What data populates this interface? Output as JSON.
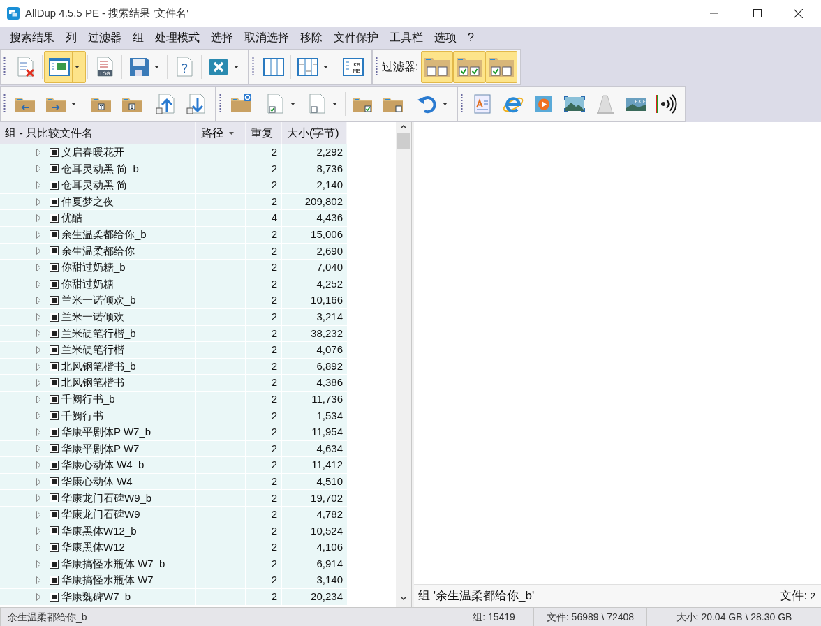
{
  "window": {
    "title": "AllDup 4.5.5 PE - 搜索结果 '文件名'"
  },
  "menu": [
    "搜索结果",
    "列",
    "过滤器",
    "组",
    "处理模式",
    "选择",
    "取消选择",
    "移除",
    "文件保护",
    "工具栏",
    "选项",
    "?"
  ],
  "toolbar_1": [
    {
      "kind": "report",
      "selected": false,
      "dropdown": false
    },
    {
      "kind": "view",
      "selected": true,
      "dropdown": true
    },
    {
      "kind": "log",
      "selected": false,
      "dropdown": false,
      "text": "LOG"
    },
    {
      "kind": "save",
      "selected": false,
      "dropdown": true
    },
    {
      "kind": "help",
      "selected": false,
      "dropdown": false,
      "text": "?"
    },
    {
      "kind": "remove",
      "selected": false,
      "dropdown": true
    },
    {
      "kind": "columns",
      "selected": false,
      "dropdown": false
    },
    {
      "kind": "column-width",
      "selected": false,
      "dropdown": true
    },
    {
      "kind": "size-unit",
      "selected": false,
      "dropdown": false,
      "text": "KB",
      "text_2": "MB"
    }
  ],
  "filter": {
    "label": "过滤器:",
    "buttons": [
      {
        "kind": "folder-checks",
        "checks": [
          false,
          false
        ],
        "selected": true
      },
      {
        "kind": "folder-checks",
        "checks": [
          true,
          true
        ],
        "selected": true
      },
      {
        "kind": "folder-checks",
        "checks": [
          true,
          false
        ],
        "selected": true
      }
    ]
  },
  "toolbar_2": [
    {
      "kind": "folder-back",
      "dropdown": false
    },
    {
      "kind": "folder-forward",
      "dropdown": true
    },
    {
      "kind": "folder-up-open",
      "dropdown": false
    },
    {
      "kind": "folder-down-open",
      "dropdown": false
    },
    {
      "kind": "file-up",
      "dropdown": false
    },
    {
      "kind": "file-down",
      "dropdown": false
    },
    {
      "kind": "folder-gear",
      "dropdown": false
    },
    {
      "kind": "file-checked",
      "dropdown": true
    },
    {
      "kind": "file-unchecked",
      "dropdown": true
    },
    {
      "kind": "folder-checked",
      "dropdown": false
    },
    {
      "kind": "folder-unchecked",
      "dropdown": false
    },
    {
      "kind": "undo",
      "dropdown": true
    },
    {
      "kind": "text-viewer",
      "dropdown": false
    },
    {
      "kind": "browser",
      "dropdown": false
    },
    {
      "kind": "media",
      "dropdown": false
    },
    {
      "kind": "image",
      "dropdown": false
    },
    {
      "kind": "cone",
      "dropdown": false
    },
    {
      "kind": "exif",
      "dropdown": false,
      "text": "EXIF"
    },
    {
      "kind": "audio",
      "dropdown": false
    }
  ],
  "table": {
    "columns": [
      {
        "label": "组 - 只比较文件名",
        "sort": false
      },
      {
        "label": "路径",
        "sort": true
      },
      {
        "label": "重复",
        "sort": false
      },
      {
        "label": "大小(字节)",
        "sort": false
      }
    ],
    "rows": [
      {
        "name": "义启春暖花开",
        "checked": true,
        "count": "2",
        "size": "2,292"
      },
      {
        "name": "仓耳灵动黑 简_b",
        "checked": true,
        "count": "2",
        "size": "8,736"
      },
      {
        "name": "仓耳灵动黑 简",
        "checked": true,
        "count": "2",
        "size": "2,140"
      },
      {
        "name": "仲夏梦之夜",
        "checked": true,
        "count": "2",
        "size": "209,802"
      },
      {
        "name": "优酷",
        "checked": true,
        "count": "4",
        "size": "4,436"
      },
      {
        "name": "余生温柔都给你_b",
        "checked": true,
        "count": "2",
        "size": "15,006"
      },
      {
        "name": "余生温柔都给你",
        "checked": true,
        "count": "2",
        "size": "2,690"
      },
      {
        "name": "你甜过奶糖_b",
        "checked": true,
        "count": "2",
        "size": "7,040"
      },
      {
        "name": "你甜过奶糖",
        "checked": true,
        "count": "2",
        "size": "4,252"
      },
      {
        "name": "兰米一诺倾欢_b",
        "checked": true,
        "count": "2",
        "size": "10,166"
      },
      {
        "name": "兰米一诺倾欢",
        "checked": true,
        "count": "2",
        "size": "3,214"
      },
      {
        "name": "兰米硬笔行楷_b",
        "checked": true,
        "count": "2",
        "size": "38,232"
      },
      {
        "name": "兰米硬笔行楷",
        "checked": true,
        "count": "2",
        "size": "4,076"
      },
      {
        "name": "北风钢笔楷书_b",
        "checked": true,
        "count": "2",
        "size": "6,892"
      },
      {
        "name": "北风钢笔楷书",
        "checked": true,
        "count": "2",
        "size": "4,386"
      },
      {
        "name": "千阙行书_b",
        "checked": true,
        "count": "2",
        "size": "11,736"
      },
      {
        "name": "千阙行书",
        "checked": true,
        "count": "2",
        "size": "1,534"
      },
      {
        "name": "华康平剧体P W7_b",
        "checked": true,
        "count": "2",
        "size": "11,954"
      },
      {
        "name": "华康平剧体P W7",
        "checked": true,
        "count": "2",
        "size": "4,634"
      },
      {
        "name": "华康心动体 W4_b",
        "checked": true,
        "count": "2",
        "size": "11,412"
      },
      {
        "name": "华康心动体 W4",
        "checked": true,
        "count": "2",
        "size": "4,510"
      },
      {
        "name": "华康龙门石碑W9_b",
        "checked": true,
        "count": "2",
        "size": "19,702"
      },
      {
        "name": "华康龙门石碑W9",
        "checked": true,
        "count": "2",
        "size": "4,782"
      },
      {
        "name": "华康黑体W12_b",
        "checked": true,
        "count": "2",
        "size": "10,524"
      },
      {
        "name": "华康黑体W12",
        "checked": true,
        "count": "2",
        "size": "4,106"
      },
      {
        "name": "华康搞怪水瓶体 W7_b",
        "checked": true,
        "count": "2",
        "size": "6,914"
      },
      {
        "name": "华康搞怪水瓶体 W7",
        "checked": true,
        "count": "2",
        "size": "3,140"
      },
      {
        "name": "华康魏碑W7_b",
        "checked": true,
        "count": "2",
        "size": "20,234"
      }
    ]
  },
  "preview": {
    "group_label": "组 '余生温柔都给你_b'",
    "files_label": "文件:",
    "files_count": "2"
  },
  "status_bar": [
    "余生温柔都给你_b",
    "组: 15419",
    "文件: 56989 \\ 72408",
    "大小: 20.04 GB \\ 28.30 GB"
  ]
}
